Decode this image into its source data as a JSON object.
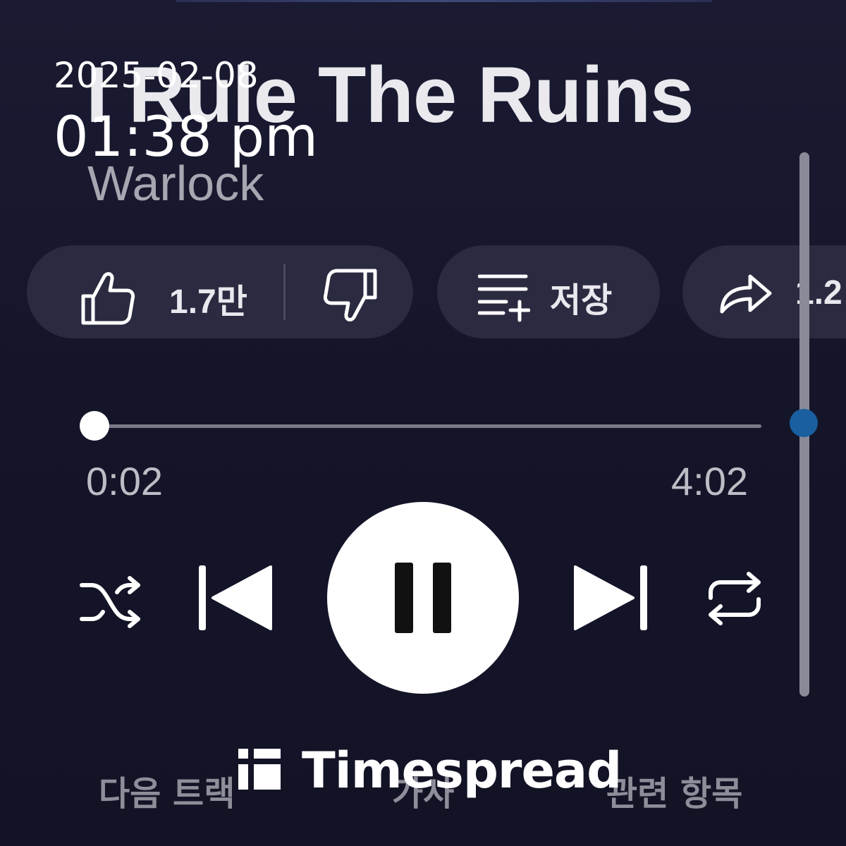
{
  "overlay": {
    "date": "2025-02-08",
    "time": "01:38 pm",
    "watermark": "Timespread"
  },
  "song": {
    "title": "I Rule The Ruins",
    "artist": "Warlock"
  },
  "actions": {
    "like_count": "1.7만",
    "save_label": "저장",
    "share_count": "1.2"
  },
  "playback": {
    "current_time": "0:02",
    "total_time": "4:02",
    "progress_fraction": 0.008,
    "state": "playing"
  },
  "bottom_tabs": {
    "next_tracks": "다음 트랙",
    "lyrics": "가사",
    "related": "관련 항목"
  },
  "icons": {
    "like": "thumbs-up-icon",
    "dislike": "thumbs-down-icon",
    "save": "playlist-add-icon",
    "share": "share-arrow-icon",
    "shuffle": "shuffle-icon",
    "previous": "skip-previous-icon",
    "pause": "pause-icon",
    "next": "skip-next-icon",
    "repeat": "repeat-icon"
  },
  "colors": {
    "background": "#15152a",
    "pill": "#2a2b40",
    "scroll_thumb": "#1a5fa0"
  }
}
